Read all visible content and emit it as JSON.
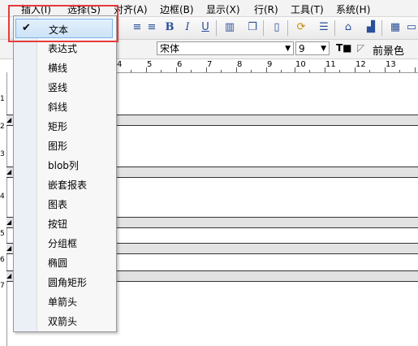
{
  "menubar": {
    "items": [
      {
        "label": "插入(I)"
      },
      {
        "label": "选择(S)"
      },
      {
        "label": "对齐(A)"
      },
      {
        "label": "边框(B)"
      },
      {
        "label": "显示(X)"
      },
      {
        "label": "行(R)"
      },
      {
        "label": "工具(T)"
      },
      {
        "label": "系统(H)"
      }
    ]
  },
  "format": {
    "font_name": "宋体",
    "font_size": "9",
    "fg_color_label": "前景色"
  },
  "ruler": {
    "numbers": [
      "4",
      "5",
      "6",
      "7",
      "8",
      "9",
      "10",
      "11",
      "12",
      "13"
    ]
  },
  "vruler": {
    "numbers": [
      "1",
      "2",
      "3",
      "4",
      "5",
      "6",
      "7"
    ]
  },
  "insert_menu": {
    "check_mark": "✔",
    "items": [
      {
        "label": "文本",
        "checked": true
      },
      {
        "label": "表达式"
      },
      {
        "label": "横线"
      },
      {
        "label": "竖线"
      },
      {
        "label": "斜线"
      },
      {
        "label": "矩形"
      },
      {
        "label": "图形"
      },
      {
        "label": "blob列"
      },
      {
        "label": "嵌套报表"
      },
      {
        "label": "图表"
      },
      {
        "label": "按钮"
      },
      {
        "label": "分组框"
      },
      {
        "label": "椭圆"
      },
      {
        "label": "圆角矩形"
      },
      {
        "label": "单箭头"
      },
      {
        "label": "双箭头"
      }
    ]
  },
  "colors": {
    "highlight_border": "#e53b3b",
    "selection_bg": "#cde3f7"
  }
}
